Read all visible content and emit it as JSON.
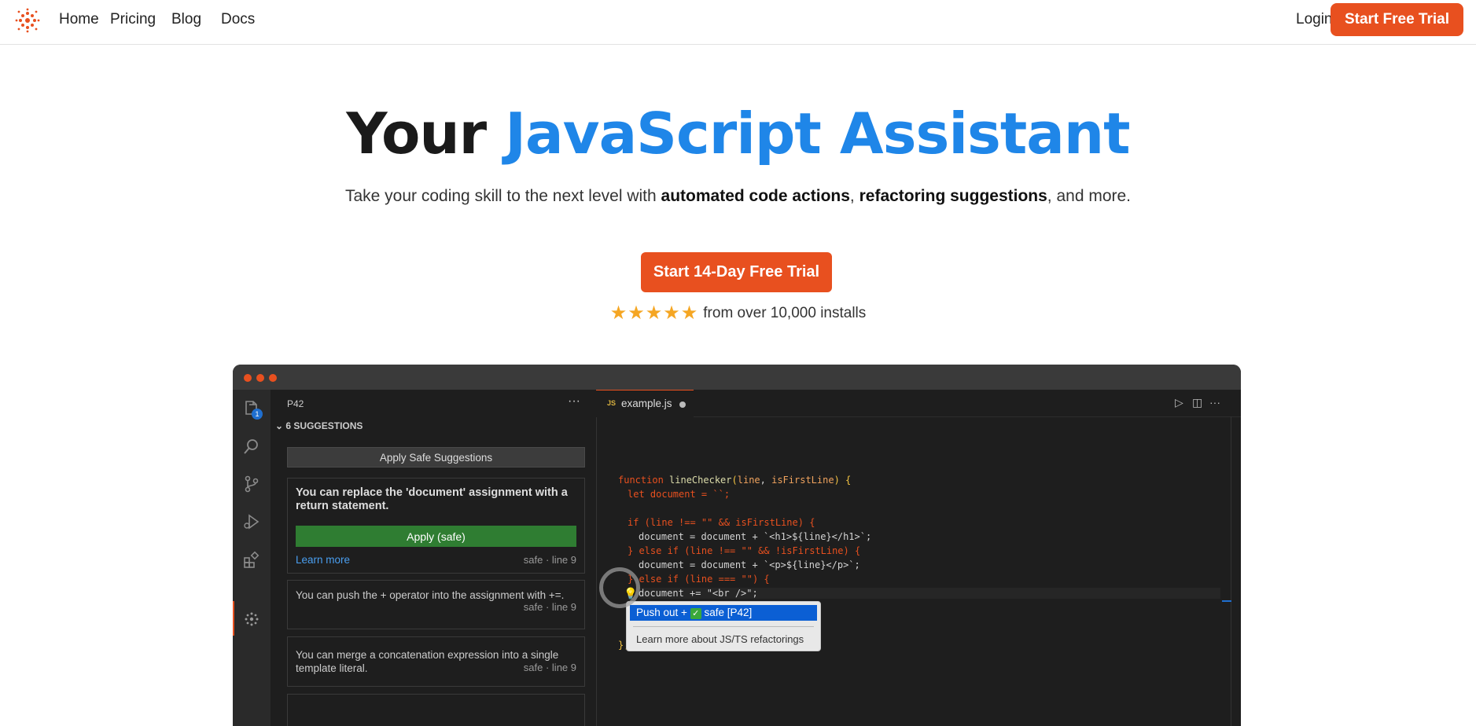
{
  "nav": {
    "links": [
      "Home",
      "Pricing",
      "Blog",
      "Docs"
    ],
    "login": "Login",
    "trial_button": "Start Free Trial"
  },
  "hero": {
    "title_plain": "Your",
    "title_accent": "JavaScript Assistant",
    "subtitle_pre": "Take your coding skill to the next level with",
    "subtitle_bold1": "automated code actions",
    "subtitle_mid": ",",
    "subtitle_bold2": "refactoring suggestions",
    "subtitle_post": ", and more.",
    "cta": "Start 14-Day Free Trial",
    "stars": "★★★★★",
    "rating_text": "from over 10,000 installs",
    "rating_value": 5
  },
  "editor": {
    "explorer_badge": "1",
    "sidebar": {
      "title": "P42",
      "more": "···",
      "section": "6 SUGGESTIONS",
      "apply_all": "Apply Safe Suggestions",
      "cards": [
        {
          "title": "You can replace the 'document' assignment with a return statement.",
          "apply": "Apply (safe)",
          "learn_more": "Learn more",
          "meta": "safe · line 9"
        },
        {
          "text": "You can push the + operator into the assignment with +=.",
          "meta": "safe · line 9"
        },
        {
          "text": "You can merge a concatenation expression into a single template literal.",
          "meta": "safe · line 9"
        }
      ]
    },
    "tab": {
      "lang": "JS",
      "filename": "example.js"
    },
    "code": {
      "l1_kw": "function",
      "l1_fn": "lineChecker",
      "l1_p1": "line",
      "l1_p2": "isFirstLine",
      "l2": "let document = ``;",
      "l3": "if (line !== \"\" && isFirstLine) {",
      "l4": "document = document + `<h1>${line}</h1>`;",
      "l5": "} else if (line !== \"\" && !isFirstLine) {",
      "l6": "document = document + `<p>${line}</p>`;",
      "l7": "} else if (line === \"\") {",
      "l8": "document += \"<br />\";",
      "l9": "};"
    },
    "menu": {
      "item1_pre": "Push out +",
      "item1_check": "✓",
      "item1_post": "safe [P42]",
      "item2": "Learn more about JS/TS refactorings"
    }
  },
  "colors": {
    "accent": "#e8501f",
    "blue": "#1f86e8",
    "star": "#f5a623"
  }
}
